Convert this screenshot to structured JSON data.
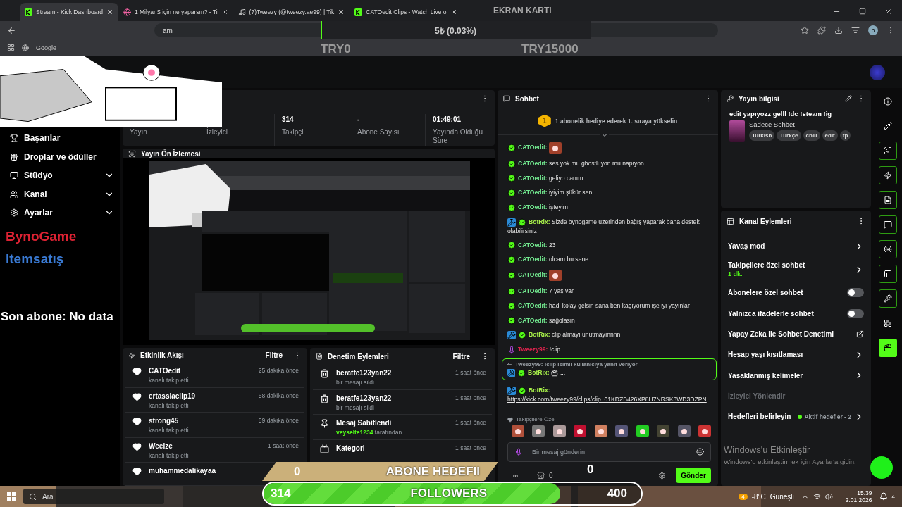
{
  "browser": {
    "tabs": [
      {
        "label": "Stream - Kick Dashboard",
        "kind": "kick",
        "selected": true
      },
      {
        "label": "1 Milyar $ için ne yaparsın? - Ti",
        "kind": "web",
        "selected": false
      },
      {
        "label": "(7)Tweezy (@tweezy.ae99) | Tik",
        "kind": "tiktok",
        "selected": false
      },
      {
        "label": "CATOedit Clips - Watch Live o",
        "kind": "kick",
        "selected": false
      }
    ],
    "address": "am",
    "bookmarks": [
      "Google"
    ],
    "profile": "b"
  },
  "donation_goal": {
    "title": "EKRAN KARTI",
    "amount": "5₺ (0.03%)",
    "level": 0.0003,
    "min": "TRY0",
    "max": "TRY15000"
  },
  "sponsors": [
    "BynoGame",
    "itemsatış"
  ],
  "sidebar": {
    "items": [
      {
        "label": "Başarılar",
        "kind": "link"
      },
      {
        "label": "Droplar ve ödüller",
        "kind": "link"
      },
      {
        "label": "Stüdyo",
        "kind": "group"
      },
      {
        "label": "Kanal",
        "kind": "group"
      },
      {
        "label": "Ayarlar",
        "kind": "group"
      }
    ]
  },
  "stats": [
    {
      "label": "Yayın"
    },
    {
      "label": "İzleyici"
    },
    {
      "value": "314",
      "label": "Takipçi"
    },
    {
      "value": "-",
      "label": "Abone Sayısı"
    },
    {
      "value": "01:49:01",
      "label": "Yayında Olduğu Süre"
    }
  ],
  "preview": {
    "title": "Yayın Ön İzlemesi",
    "overlay_text": "Son abone: No data"
  },
  "activity": {
    "title": "Etkinlik Akışı",
    "filter": "Filtre",
    "items": [
      {
        "name": "CATOedit",
        "action": "kanalı takip etti",
        "time": "25 dakika önce"
      },
      {
        "name": "ertasslaclip19",
        "action": "kanalı takip etti",
        "time": "58 dakika önce"
      },
      {
        "name": "strong45",
        "action": "kanalı takip etti",
        "time": "59 dakika önce"
      },
      {
        "name": "Weeize",
        "action": "kanalı takip etti",
        "time": "1 saat önce"
      },
      {
        "name": "muhammedalikayaa"
      }
    ]
  },
  "moderation": {
    "title": "Denetim Eylemleri",
    "filter": "Filtre",
    "items": [
      {
        "kind": "delete",
        "title": "beratfe123yan22",
        "detail": "bir mesajı sildi",
        "time": "1 saat önce"
      },
      {
        "kind": "delete",
        "title": "beratfe123yan22",
        "detail": "bir mesajı sildi",
        "time": "1 saat önce"
      },
      {
        "kind": "pin",
        "title": "Mesaj Sabitlendi",
        "by": "veyselte1234",
        "detail": "tarafından",
        "time": "1 saat önce"
      },
      {
        "kind": "category",
        "title": "Kategori",
        "time": "1 saat önce"
      }
    ]
  },
  "chat": {
    "title": "Sohbet",
    "rank": "1",
    "prompt": "1 abonelik hediye ederek 1. sıraya yükselin",
    "messages": [
      {
        "user": "CATOedit:",
        "color": "#72e88f",
        "bot": false,
        "verified": true,
        "mic": false,
        "kind": "emote"
      },
      {
        "user": "CATOedit:",
        "color": "#72e88f",
        "bot": false,
        "verified": true,
        "mic": false,
        "kind": "text",
        "text": "ses yok mu ghostluyon mu napıyon"
      },
      {
        "user": "CATOedit:",
        "color": "#72e88f",
        "bot": false,
        "verified": true,
        "mic": false,
        "kind": "text",
        "text": "geliyo canım"
      },
      {
        "user": "CATOedit:",
        "color": "#72e88f",
        "bot": false,
        "verified": true,
        "mic": false,
        "kind": "text",
        "text": "iyiyim şükür sen"
      },
      {
        "user": "CATOedit:",
        "color": "#72e88f",
        "bot": false,
        "verified": true,
        "mic": false,
        "kind": "text",
        "text": "işteyim"
      },
      {
        "user": "BotRix:",
        "color": "#a8f04a",
        "bot": true,
        "verified": true,
        "mic": false,
        "kind": "text",
        "text": "Sizde bynogame üzerinden bağış yaparak bana destek olabilirsiniz"
      },
      {
        "user": "CATOedit:",
        "color": "#72e88f",
        "bot": false,
        "verified": true,
        "mic": false,
        "kind": "text",
        "text": "23"
      },
      {
        "user": "CATOedit:",
        "color": "#72e88f",
        "bot": false,
        "verified": true,
        "mic": false,
        "kind": "text",
        "text": "olcam bu sene"
      },
      {
        "user": "CATOedit:",
        "color": "#72e88f",
        "bot": false,
        "verified": true,
        "mic": false,
        "kind": "emote"
      },
      {
        "user": "CATOedit:",
        "color": "#72e88f",
        "bot": false,
        "verified": true,
        "mic": false,
        "kind": "text",
        "text": "7 yaş var"
      },
      {
        "user": "CATOedit:",
        "color": "#72e88f",
        "bot": false,
        "verified": true,
        "mic": false,
        "kind": "text",
        "text": "hadi kolay gelsin sana ben kaçıyorum işe iyi yayınlar"
      },
      {
        "user": "CATOedit:",
        "color": "#72e88f",
        "bot": false,
        "verified": true,
        "mic": false,
        "kind": "text",
        "text": "sağolasın"
      },
      {
        "user": "BotRix:",
        "color": "#a8f04a",
        "bot": true,
        "verified": true,
        "mic": false,
        "kind": "text",
        "text": "clip almayı unutmayınnnn"
      },
      {
        "user": "Tweezy99:",
        "color": "#e0234e",
        "bot": false,
        "verified": false,
        "mic": true,
        "kind": "text",
        "text": "!clip"
      },
      {
        "user": "BotRix:",
        "color": "#a8f04a",
        "bot": true,
        "verified": true,
        "mic": false,
        "kind": "reply",
        "reply_to": "Tweezy99: !clip isimli kullanıcıya yanıt veriyor",
        "emote": true,
        "text": "..."
      },
      {
        "user": "BotRix:",
        "color": "#a8f04a",
        "bot": true,
        "verified": true,
        "mic": false,
        "kind": "link",
        "text": "https://kick.com/tweezy99/clips/clip_01KDZB426XP8H7NRSK3WD3DZPN"
      }
    ],
    "emote_section": "Takipçilere Özel",
    "placeholder": "Bir mesaj gönderin",
    "points": "∞",
    "store_count": "0",
    "send": "Gönder"
  },
  "stream_info": {
    "title": "Yayın bilgisi",
    "stream_title": "edit yapıyozz gelll !dc !steam !ig",
    "category": "Sadece Sohbet",
    "tags": [
      "Turkish",
      "Türkçe",
      "chill",
      "edit",
      "fp"
    ]
  },
  "channel_actions": {
    "title": "Kanal Eylemleri",
    "items": [
      {
        "kind": "chevron",
        "label": "Yavaş mod"
      },
      {
        "kind": "chevron",
        "label": "Takipçilere özel sohbet",
        "detail": "1 dk."
      },
      {
        "kind": "toggle",
        "label": "Abonelere özel sohbet",
        "on": false
      },
      {
        "kind": "toggle",
        "label": "Yalnızca ifadelerle sohbet",
        "on": false
      },
      {
        "kind": "external",
        "label": "Yapay Zeka ile Sohbet Denetimi"
      },
      {
        "kind": "chevron",
        "label": "Hesap yaşı kısıtlaması"
      },
      {
        "kind": "chevron",
        "label": "Yasaklanmış kelimeler"
      },
      {
        "kind": "section",
        "label": "İzleyici Yönlendir"
      },
      {
        "kind": "chevron",
        "label": "Hedefleri belirleyin",
        "status": "Aktif hedefler - 2"
      }
    ]
  },
  "rail": [
    {
      "on": false,
      "selected": false
    },
    {
      "on": false,
      "selected": false
    },
    {
      "on": true,
      "selected": false
    },
    {
      "on": true,
      "selected": false
    },
    {
      "on": true,
      "selected": false
    },
    {
      "on": true,
      "selected": false
    },
    {
      "on": true,
      "selected": false
    },
    {
      "on": true,
      "selected": false
    },
    {
      "on": true,
      "selected": false
    },
    {
      "on": false,
      "selected": false
    },
    {
      "on": false,
      "selected": true
    }
  ],
  "sub_goal": {
    "current": "0",
    "title": "ABONE HEDEFII",
    "target": "0",
    "level": 0
  },
  "follower_goal": {
    "current": "314",
    "title": "FOLLOWERS",
    "target": "400",
    "level": 0.785
  },
  "activation": {
    "title": "Windows'u Etkinleştir",
    "text": "Windows'u etkinleştirmek için Ayarlar'a gidin."
  },
  "taskbar": {
    "search": "Ara",
    "weather_badge": "4",
    "weather": "-8°C",
    "condition": "Güneşli",
    "time": "15:39",
    "date": "2.01.2026",
    "notifications": "4"
  }
}
